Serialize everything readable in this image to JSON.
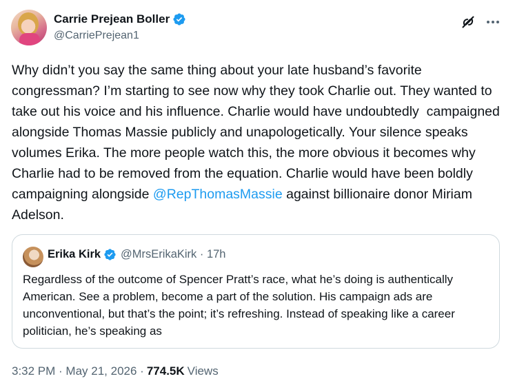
{
  "author": {
    "display_name": "Carrie Prejean Boller",
    "handle": "@CarriePrejean1"
  },
  "post": {
    "text_before_mention": "Why didn’t you say the same thing about your late husband’s favorite congressman? I’m starting to see now why they took Charlie out. They wanted to take out his voice and his influence. Charlie would have undoubtedly  campaigned alongside Thomas Massie publicly and unapologetically. Your silence speaks volumes Erika. The more people watch this, the more obvious it becomes why Charlie had to be removed from the equation. Charlie would have been boldly campaigning alongside ",
    "mention": "@RepThomasMassie",
    "text_after_mention": " against billionaire donor Miriam Adelson."
  },
  "quoted": {
    "display_name": "Erika Kirk",
    "handle_time": "@MrsErikaKirk · 17h",
    "text": "Regardless of the outcome of Spencer Pratt’s race,  what he’s doing is authentically American. See a problem, become a part of the solution. His campaign ads are unconventional, but that’s the point; it’s refreshing. Instead of speaking like a career politician, he’s speaking as"
  },
  "meta": {
    "timestamp": "3:32 PM · May 21, 2026 ·",
    "views_count": "774.5K",
    "views_label": "Views"
  },
  "icons": {
    "verified": "verified-badge-icon",
    "grok": "grok-icon",
    "more": "more-options-icon"
  },
  "colors": {
    "verified": "#1d9bf0",
    "mention": "#1d9bf0",
    "secondary_text": "#536471"
  }
}
